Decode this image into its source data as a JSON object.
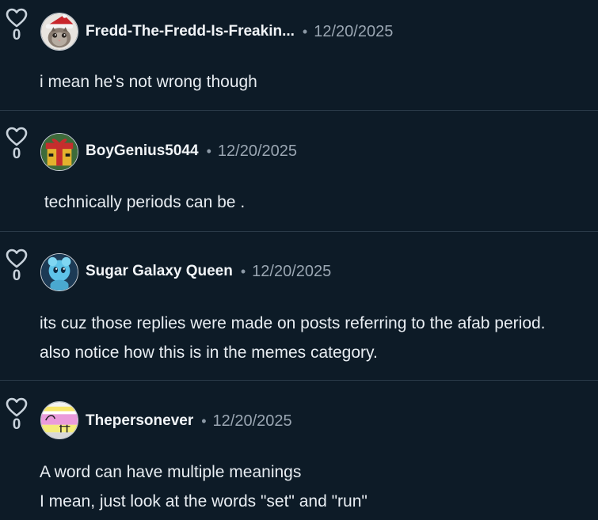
{
  "colors": {
    "background": "#0d1b27",
    "divider": "#2a3a48",
    "text": "#e8edf2",
    "muted": "#9aa6b2"
  },
  "comments": [
    {
      "likes": "0",
      "avatar": "cat-in-santa-hat-avatar",
      "username": "Fredd-The-Fredd-Is-Freakin...",
      "separator": "•",
      "date": "12/20/2025",
      "lines": [
        "i mean he's not wrong though"
      ]
    },
    {
      "likes": "0",
      "avatar": "gift-box-avatar",
      "username": "BoyGenius5044",
      "separator": "•",
      "date": "12/20/2025",
      "lines": [
        " technically periods can be ."
      ]
    },
    {
      "likes": "0",
      "avatar": "blue-character-avatar",
      "username": "Sugar Galaxy Queen",
      "separator": "•",
      "date": "12/20/2025",
      "lines": [
        "its cuz those replies were made on posts referring to the afab period.",
        "also notice how this is in the memes category."
      ]
    },
    {
      "likes": "0",
      "avatar": "striped-cartoon-avatar",
      "username": "Thepersonever",
      "separator": "•",
      "date": "12/20/2025",
      "lines": [
        "A word can have multiple meanings",
        "I mean, just look at the words \"set\" and \"run\""
      ]
    }
  ]
}
